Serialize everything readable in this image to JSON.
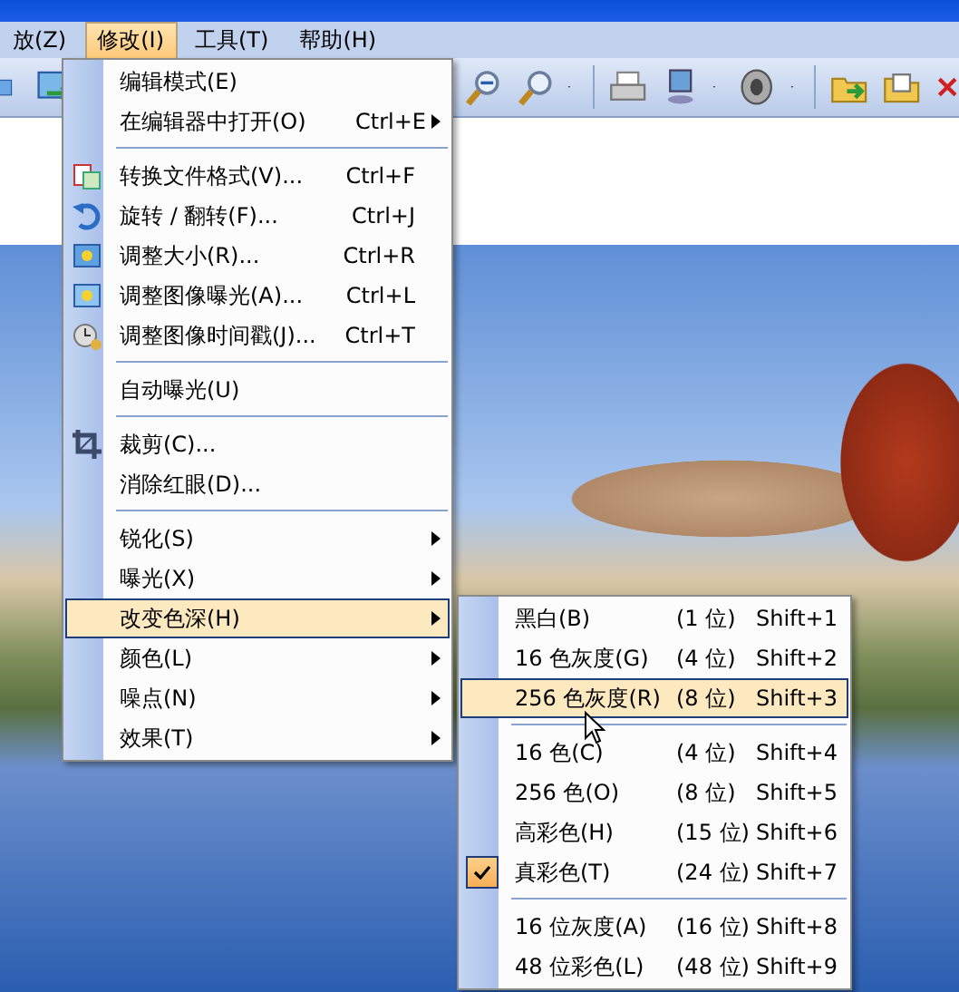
{
  "menubar": [
    {
      "label": "放(Z)",
      "selected": false
    },
    {
      "label": "修改(I)",
      "selected": true
    },
    {
      "label": "工具(T)",
      "selected": false
    },
    {
      "label": "帮助(H)",
      "selected": false
    }
  ],
  "menu": {
    "items": [
      {
        "kind": "item",
        "label": "编辑模式(E)",
        "submenu": false,
        "selected": false
      },
      {
        "kind": "item",
        "label": "在编辑器中打开(O)",
        "shortcut": "Ctrl+E",
        "submenu": true,
        "selected": false
      },
      {
        "kind": "separator"
      },
      {
        "kind": "item",
        "label": "转换文件格式(V)...",
        "shortcut": "Ctrl+F",
        "submenu": false,
        "selected": false
      },
      {
        "kind": "item",
        "label": "旋转 / 翻转(F)...",
        "shortcut": "Ctrl+J",
        "submenu": false,
        "selected": false
      },
      {
        "kind": "item",
        "label": "调整大小(R)...",
        "shortcut": "Ctrl+R",
        "submenu": false,
        "selected": false
      },
      {
        "kind": "item",
        "label": "调整图像曝光(A)...",
        "shortcut": "Ctrl+L",
        "submenu": false,
        "selected": false
      },
      {
        "kind": "item",
        "label": "调整图像时间戳(J)...",
        "shortcut": "Ctrl+T",
        "submenu": false,
        "selected": false
      },
      {
        "kind": "separator"
      },
      {
        "kind": "item",
        "label": "自动曝光(U)",
        "submenu": false,
        "selected": false
      },
      {
        "kind": "separator"
      },
      {
        "kind": "item",
        "label": "裁剪(C)...",
        "submenu": false,
        "selected": false
      },
      {
        "kind": "item",
        "label": "消除红眼(D)...",
        "submenu": false,
        "selected": false
      },
      {
        "kind": "separator"
      },
      {
        "kind": "item",
        "label": "锐化(S)",
        "submenu": true,
        "selected": false
      },
      {
        "kind": "item",
        "label": "曝光(X)",
        "submenu": true,
        "selected": false
      },
      {
        "kind": "item",
        "label": "改变色深(H)",
        "submenu": true,
        "selected": true
      },
      {
        "kind": "item",
        "label": "颜色(L)",
        "submenu": true,
        "selected": false
      },
      {
        "kind": "item",
        "label": "噪点(N)",
        "submenu": true,
        "selected": false
      },
      {
        "kind": "item",
        "label": "效果(T)",
        "submenu": true,
        "selected": false
      }
    ]
  },
  "submenu": {
    "items": [
      {
        "kind": "item",
        "label": "黑白(B)",
        "bits": "(1 位)",
        "shortcut": "Shift+1",
        "checked": false,
        "selected": false
      },
      {
        "kind": "item",
        "label": "16 色灰度(G)",
        "bits": "(4 位)",
        "shortcut": "Shift+2",
        "checked": false,
        "selected": false
      },
      {
        "kind": "item",
        "label": "256 色灰度(R)",
        "bits": "(8 位)",
        "shortcut": "Shift+3",
        "checked": false,
        "selected": true
      },
      {
        "kind": "separator"
      },
      {
        "kind": "item",
        "label": "16 色(C)",
        "bits": "(4 位)",
        "shortcut": "Shift+4",
        "checked": false,
        "selected": false
      },
      {
        "kind": "item",
        "label": "256 色(O)",
        "bits": "(8 位)",
        "shortcut": "Shift+5",
        "checked": false,
        "selected": false
      },
      {
        "kind": "item",
        "label": "高彩色(H)",
        "bits": "(15 位)",
        "shortcut": "Shift+6",
        "checked": false,
        "selected": false
      },
      {
        "kind": "item",
        "label": "真彩色(T)",
        "bits": "(24 位)",
        "shortcut": "Shift+7",
        "checked": true,
        "selected": false
      },
      {
        "kind": "separator"
      },
      {
        "kind": "item",
        "label": "16 位灰度(A)",
        "bits": "(16 位)",
        "shortcut": "Shift+8",
        "checked": false,
        "selected": false
      },
      {
        "kind": "item",
        "label": "48 位彩色(L)",
        "bits": "(48 位)",
        "shortcut": "Shift+9",
        "checked": false,
        "selected": false
      }
    ]
  }
}
